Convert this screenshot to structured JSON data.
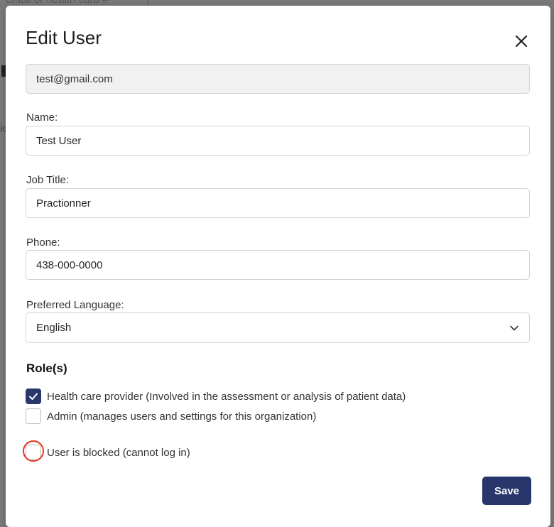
{
  "background": {
    "search_hint": "email or health card #"
  },
  "modal": {
    "title": "Edit User",
    "close_icon": "close-icon"
  },
  "form": {
    "email": {
      "value": "test@gmail.com"
    },
    "name": {
      "label": "Name:",
      "value": "Test User"
    },
    "job_title": {
      "label": "Job Title:",
      "value": "Practionner"
    },
    "phone": {
      "label": "Phone:",
      "value": "438-000-0000"
    },
    "preferred_language": {
      "label": "Preferred Language:",
      "selected": "English"
    }
  },
  "roles": {
    "heading": "Role(s)",
    "items": [
      {
        "label": "Health care provider (Involved in the assessment or analysis of patient data)",
        "checked": true
      },
      {
        "label": "Admin (manages users and settings for this organization)",
        "checked": false
      }
    ]
  },
  "blocked": {
    "label": "User is blocked (cannot log in)",
    "checked": false
  },
  "actions": {
    "save_label": "Save"
  },
  "colors": {
    "primary": "#27366b",
    "highlight": "#e8331e",
    "readonly_bg": "#f1f1f1"
  }
}
